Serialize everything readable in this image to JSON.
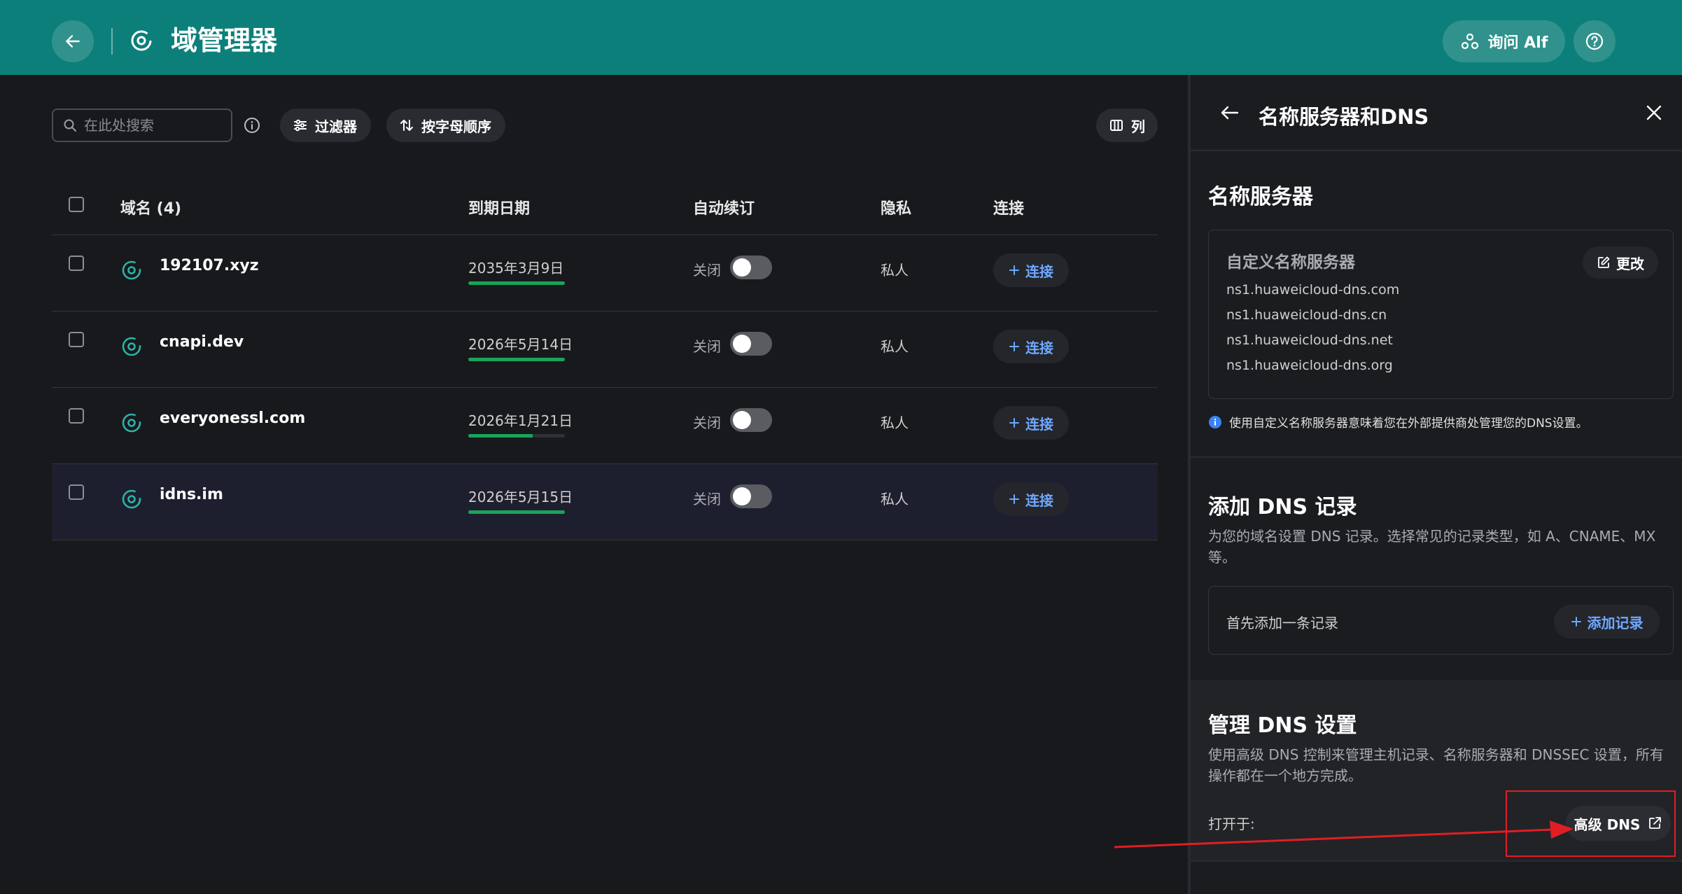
{
  "header": {
    "title": "域管理器",
    "ask_label": "询问 Alf"
  },
  "toolbar": {
    "search_placeholder": "在此处搜索",
    "filter_label": "过滤器",
    "sort_label": "按字母顺序",
    "columns_label": "列"
  },
  "table": {
    "headers": {
      "domain": "域名 (4)",
      "expiry": "到期日期",
      "autorenew": "自动续订",
      "privacy": "隐私",
      "connect": "连接"
    },
    "rows": [
      {
        "domain": "192107.xyz",
        "expiry": "2035年3月9日",
        "expiry_progress": 1.0,
        "autorenew": "关闭",
        "autorenew_on": false,
        "privacy": "私人",
        "connect": "连接"
      },
      {
        "domain": "cnapi.dev",
        "expiry": "2026年5月14日",
        "expiry_progress": 1.0,
        "autorenew": "关闭",
        "autorenew_on": false,
        "privacy": "私人",
        "connect": "连接"
      },
      {
        "domain": "everyonessl.com",
        "expiry": "2026年1月21日",
        "expiry_progress": 0.67,
        "autorenew": "关闭",
        "autorenew_on": false,
        "privacy": "私人",
        "connect": "连接"
      },
      {
        "domain": "idns.im",
        "expiry": "2026年5月15日",
        "expiry_progress": 1.0,
        "autorenew": "关闭",
        "autorenew_on": false,
        "privacy": "私人",
        "connect": "连接"
      }
    ]
  },
  "panel": {
    "title": "名称服务器和DNS",
    "nameservers": {
      "title": "名称服务器",
      "box_label": "自定义名称服务器",
      "change_label": "更改",
      "items": [
        "ns1.huaweicloud-dns.com",
        "ns1.huaweicloud-dns.cn",
        "ns1.huaweicloud-dns.net",
        "ns1.huaweicloud-dns.org"
      ],
      "note": "使用自定义名称服务器意味着您在外部提供商处管理您的DNS设置。"
    },
    "add_dns": {
      "title": "添加 DNS 记录",
      "desc": "为您的域名设置 DNS 记录。选择常见的记录类型，如 A、CNAME、MX 等。",
      "empty_text": "首先添加一条记录",
      "add_label": "添加记录"
    },
    "manage_dns": {
      "title": "管理 DNS 设置",
      "desc": "使用高级 DNS 控制来管理主机记录、名称服务器和 DNSSEC 设置，所有操作都在一个地方完成。",
      "open_label": "打开于:",
      "advanced_label": "高级 DNS"
    }
  },
  "colors": {
    "header_bg": "#0d7f7a",
    "accent_blue": "#6ea8ff",
    "progress_green": "#1aa35a",
    "annotation_red": "#e01e24"
  }
}
